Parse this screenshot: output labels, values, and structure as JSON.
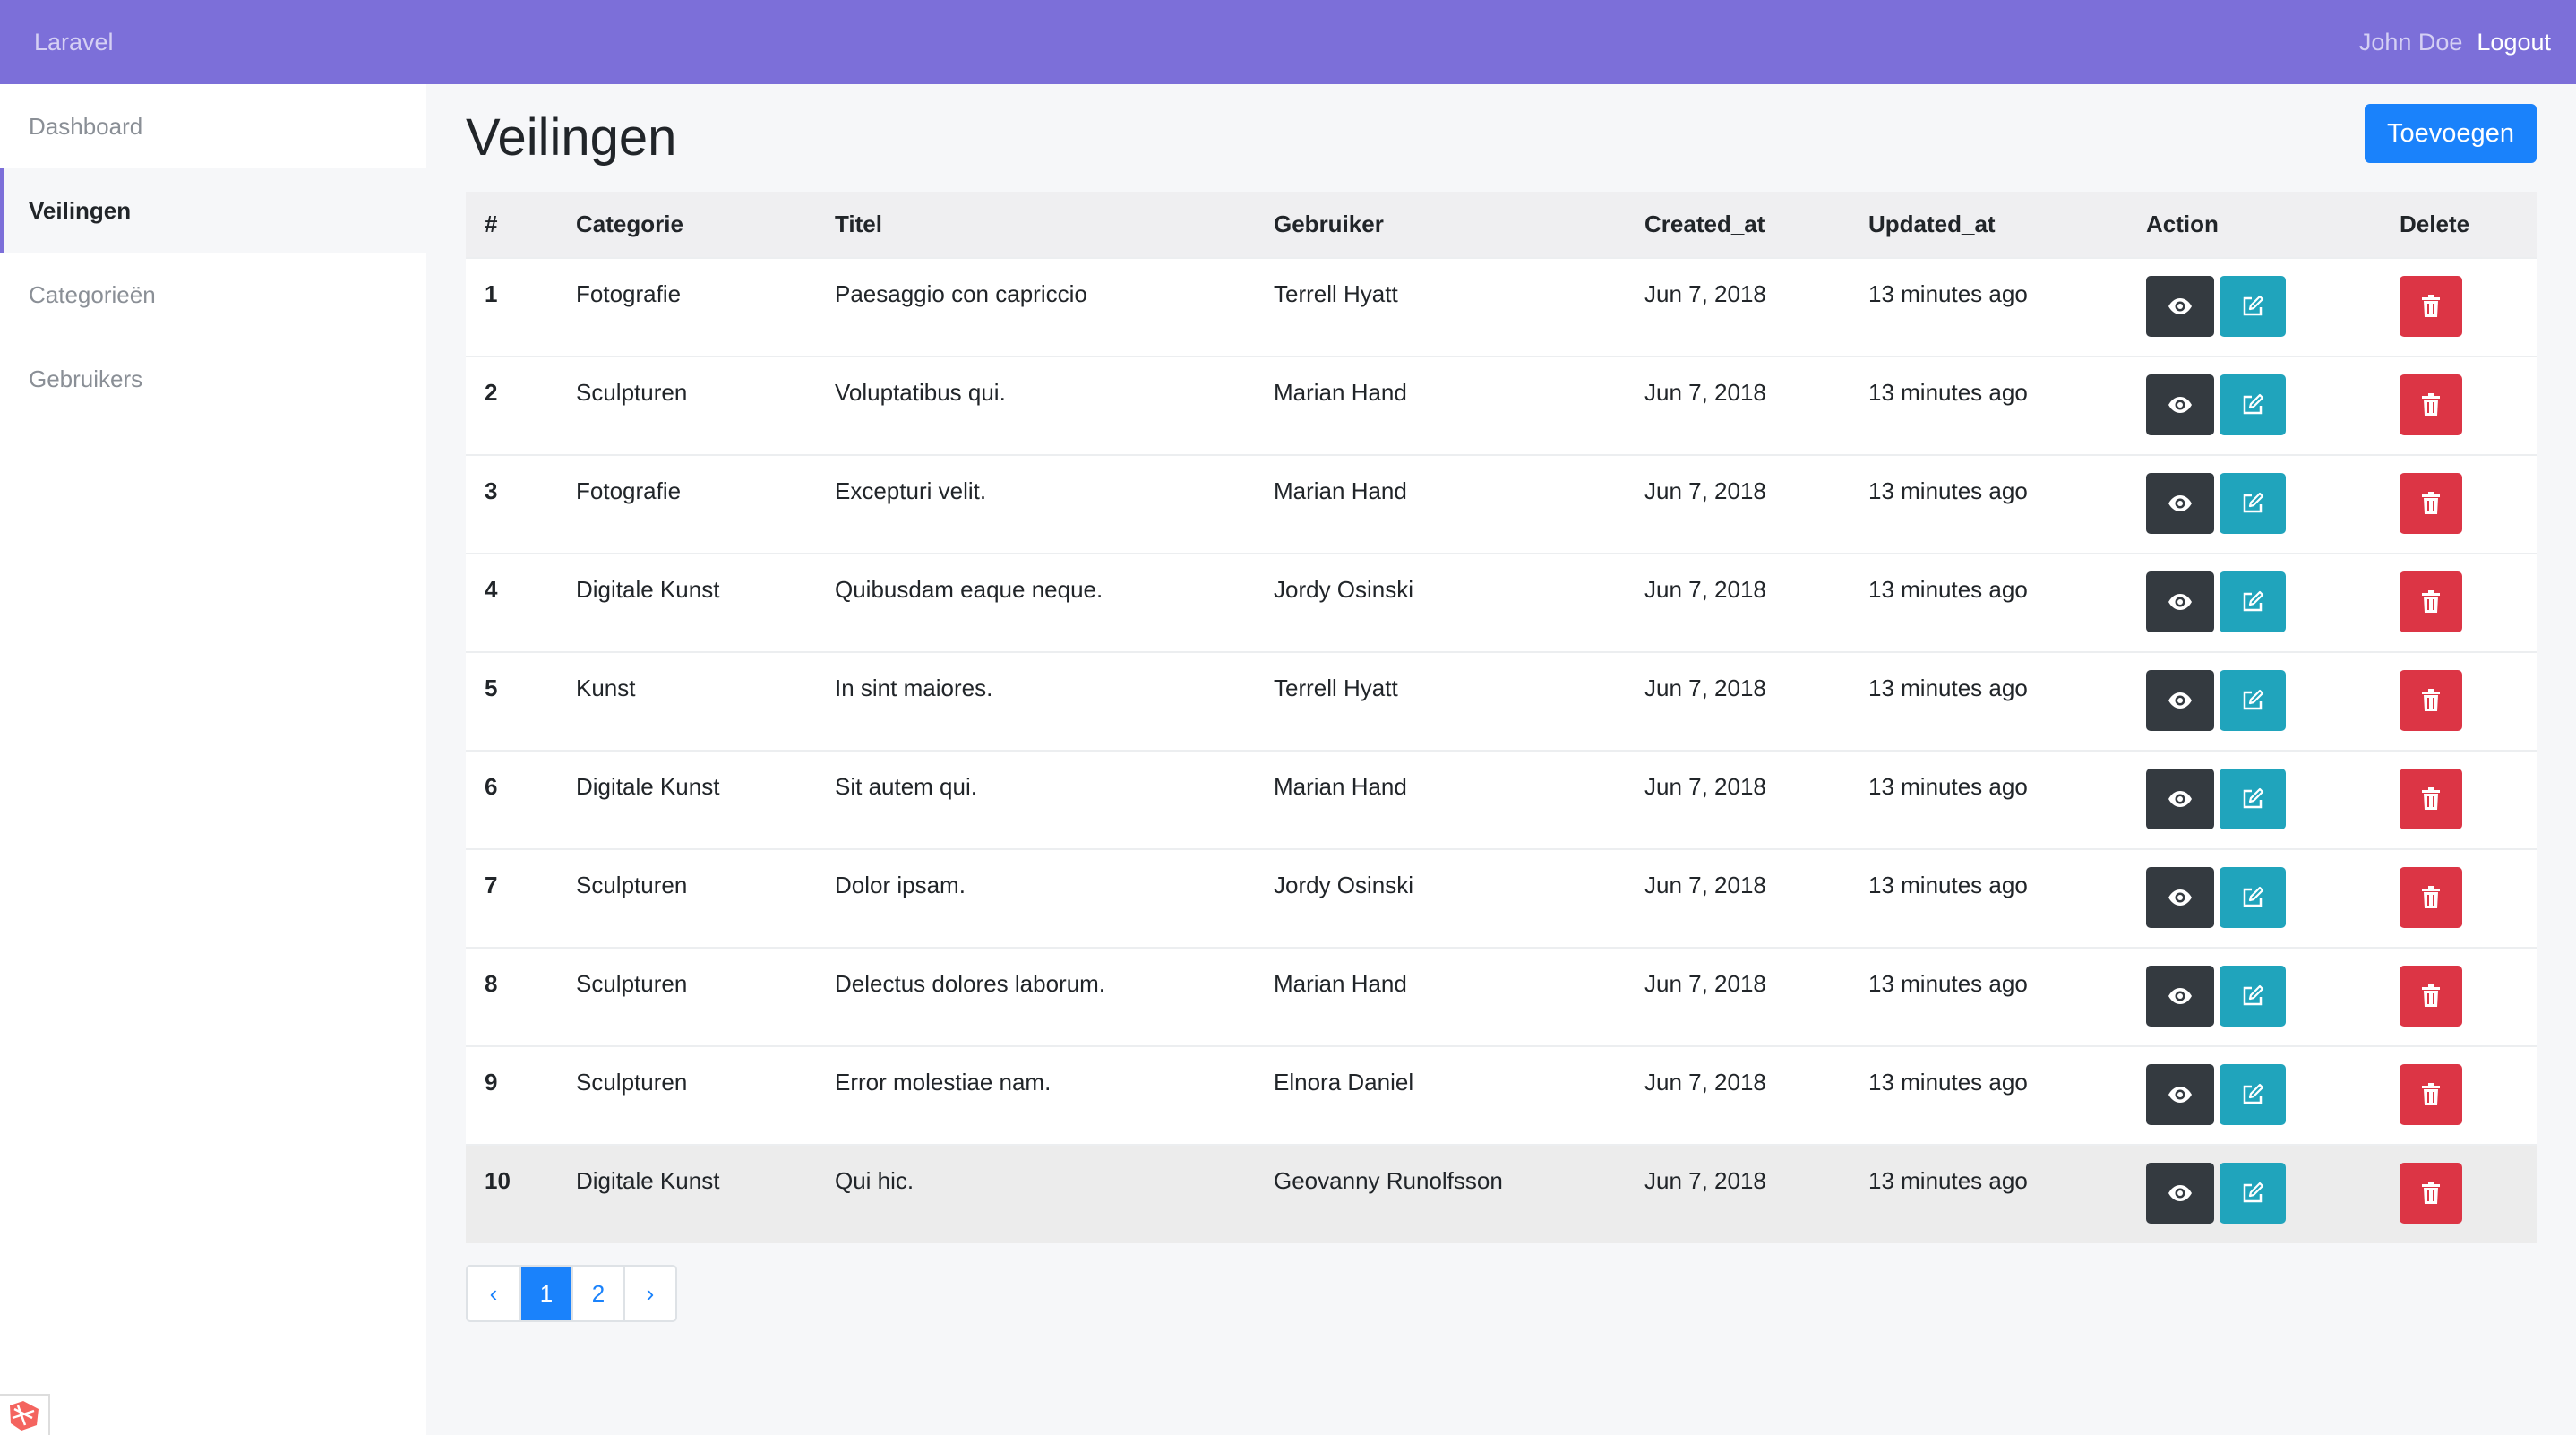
{
  "navbar": {
    "brand": "Laravel",
    "user": "John Doe",
    "logout": "Logout"
  },
  "sidebar": {
    "items": [
      {
        "label": "Dashboard"
      },
      {
        "label": "Veilingen"
      },
      {
        "label": "Categorieën"
      },
      {
        "label": "Gebruikers"
      }
    ]
  },
  "page": {
    "title": "Veilingen",
    "add_button": "Toevoegen"
  },
  "table": {
    "headers": [
      "#",
      "Categorie",
      "Titel",
      "Gebruiker",
      "Created_at",
      "Updated_at",
      "Action",
      "Delete"
    ],
    "rows": [
      {
        "id": "1",
        "categorie": "Fotografie",
        "titel": "Paesaggio con capriccio",
        "gebruiker": "Terrell Hyatt",
        "created": "Jun 7, 2018",
        "updated": "13 minutes ago"
      },
      {
        "id": "2",
        "categorie": "Sculpturen",
        "titel": "Voluptatibus qui.",
        "gebruiker": "Marian Hand",
        "created": "Jun 7, 2018",
        "updated": "13 minutes ago"
      },
      {
        "id": "3",
        "categorie": "Fotografie",
        "titel": "Excepturi velit.",
        "gebruiker": "Marian Hand",
        "created": "Jun 7, 2018",
        "updated": "13 minutes ago"
      },
      {
        "id": "4",
        "categorie": "Digitale Kunst",
        "titel": "Quibusdam eaque neque.",
        "gebruiker": "Jordy Osinski",
        "created": "Jun 7, 2018",
        "updated": "13 minutes ago"
      },
      {
        "id": "5",
        "categorie": "Kunst",
        "titel": "In sint maiores.",
        "gebruiker": "Terrell Hyatt",
        "created": "Jun 7, 2018",
        "updated": "13 minutes ago"
      },
      {
        "id": "6",
        "categorie": "Digitale Kunst",
        "titel": "Sit autem qui.",
        "gebruiker": "Marian Hand",
        "created": "Jun 7, 2018",
        "updated": "13 minutes ago"
      },
      {
        "id": "7",
        "categorie": "Sculpturen",
        "titel": "Dolor ipsam.",
        "gebruiker": "Jordy Osinski",
        "created": "Jun 7, 2018",
        "updated": "13 minutes ago"
      },
      {
        "id": "8",
        "categorie": "Sculpturen",
        "titel": "Delectus dolores laborum.",
        "gebruiker": "Marian Hand",
        "created": "Jun 7, 2018",
        "updated": "13 minutes ago"
      },
      {
        "id": "9",
        "categorie": "Sculpturen",
        "titel": "Error molestiae nam.",
        "gebruiker": "Elnora Daniel",
        "created": "Jun 7, 2018",
        "updated": "13 minutes ago"
      },
      {
        "id": "10",
        "categorie": "Digitale Kunst",
        "titel": "Qui hic.",
        "gebruiker": "Geovanny Runolfsson",
        "created": "Jun 7, 2018",
        "updated": "13 minutes ago"
      }
    ]
  },
  "pagination": {
    "prev": "‹",
    "pages": [
      "1",
      "2"
    ],
    "next": "›",
    "current": "1"
  },
  "icons": {
    "view": "eye-icon",
    "edit": "edit-icon",
    "delete": "trash-icon",
    "debugbar": "laravel-logo-icon"
  },
  "colors": {
    "navbar": "#7c6fd9",
    "primary": "#1a82fb",
    "dark": "#343a40",
    "info": "#20a4bc",
    "danger": "#dc3545"
  }
}
